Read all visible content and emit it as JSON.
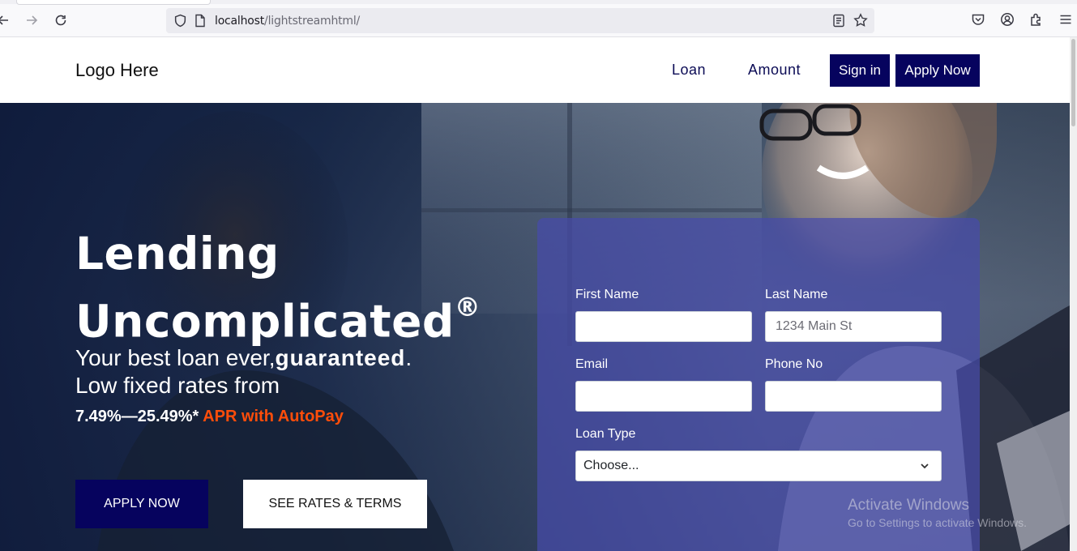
{
  "browser": {
    "url_host": "localhost",
    "url_path": "/lightstreamhtml/"
  },
  "header": {
    "logo": "Logo Here",
    "nav": [
      "Loan",
      "Amount"
    ],
    "sign_in": "Sign in",
    "apply_now": "Apply Now"
  },
  "hero": {
    "title_line1": "Lending",
    "title_line2": "Uncomplicated",
    "title_mark": "®",
    "sub_line1_a": "Your best loan ever,",
    "sub_line1_b": "guaranteed",
    "sub_line1_c": ".",
    "sub_line2": "Low fixed rates from",
    "rate_range": "7.49%—25.49%*",
    "rate_apr": "APR with AutoPay",
    "apply_button": "APPLY NOW",
    "rates_button": "SEE RATES & TERMS"
  },
  "form": {
    "first_name_label": "First Name",
    "first_name_value": "",
    "last_name_label": "Last Name",
    "last_name_value": "1234 Main St",
    "email_label": "Email",
    "email_value": "",
    "phone_label": "Phone No",
    "phone_value": "",
    "loan_type_label": "Loan Type",
    "loan_type_selected": "Choose..."
  },
  "watermark": {
    "line1": "Activate Windows",
    "line2": "Go to Settings to activate Windows."
  },
  "colors": {
    "brand_navy": "#06035e",
    "accent_orange": "#ff4d0a"
  }
}
